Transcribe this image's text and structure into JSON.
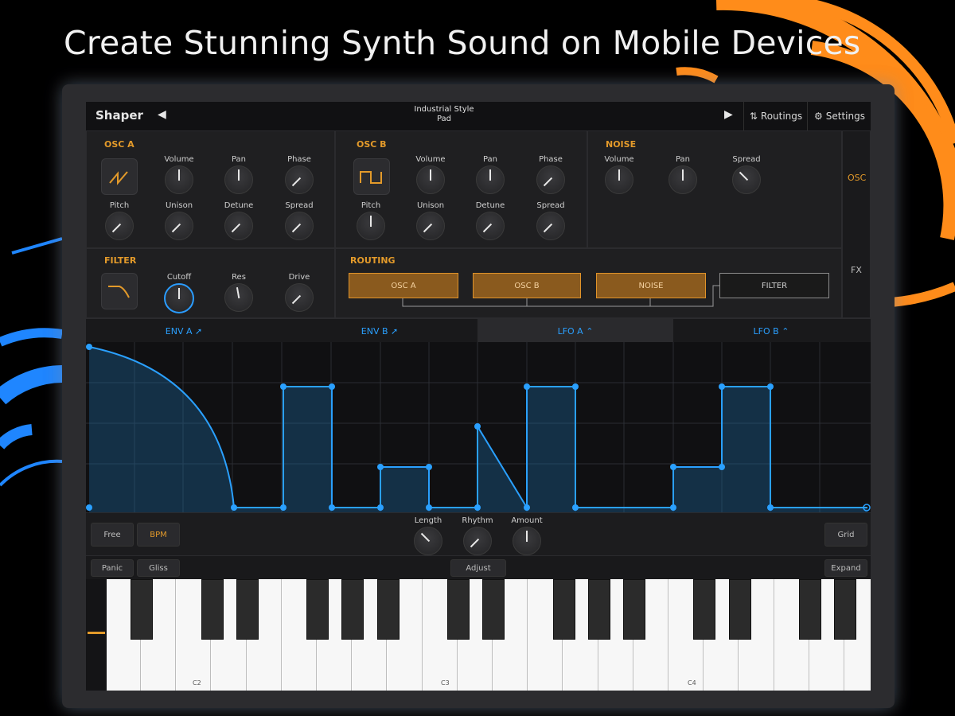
{
  "headline": "Create Stunning Synth Sound on Mobile Devices",
  "topbar": {
    "title": "Shaper",
    "preset_line1": "Industrial Style",
    "preset_line2": "Pad",
    "routings": "Routings",
    "settings": "Settings"
  },
  "osc_a": {
    "title": "OSC A",
    "knobs": [
      "Volume",
      "Pan",
      "Phase",
      "Pitch",
      "Unison",
      "Detune",
      "Spread"
    ]
  },
  "osc_b": {
    "title": "OSC B",
    "knobs": [
      "Volume",
      "Pan",
      "Phase",
      "Pitch",
      "Unison",
      "Detune",
      "Spread"
    ]
  },
  "noise": {
    "title": "NOISE",
    "knobs": [
      "Volume",
      "Pan",
      "Spread"
    ]
  },
  "filter": {
    "title": "FILTER",
    "knobs": [
      "Cutoff",
      "Res",
      "Drive"
    ]
  },
  "routing": {
    "title": "ROUTING",
    "sources": [
      "OSC A",
      "OSC B",
      "NOISE"
    ],
    "dest": "FILTER"
  },
  "side_tabs": [
    "OSC",
    "FX"
  ],
  "mod_tabs": [
    "ENV A",
    "ENV B",
    "LFO A",
    "LFO B"
  ],
  "active_mod_tab": "LFO A",
  "mod_controls": {
    "free": "Free",
    "bpm": "BPM",
    "knobs": [
      "Length",
      "Rhythm",
      "Amount"
    ],
    "grid": "Grid"
  },
  "keyboard_bar": {
    "panic": "Panic",
    "gliss": "Gliss",
    "adjust": "Adjust",
    "expand": "Expand"
  },
  "octave_labels": [
    "C2",
    "C3",
    "C4"
  ],
  "colors": {
    "accent_orange": "#e39a2a",
    "accent_blue": "#2aa0ff"
  }
}
